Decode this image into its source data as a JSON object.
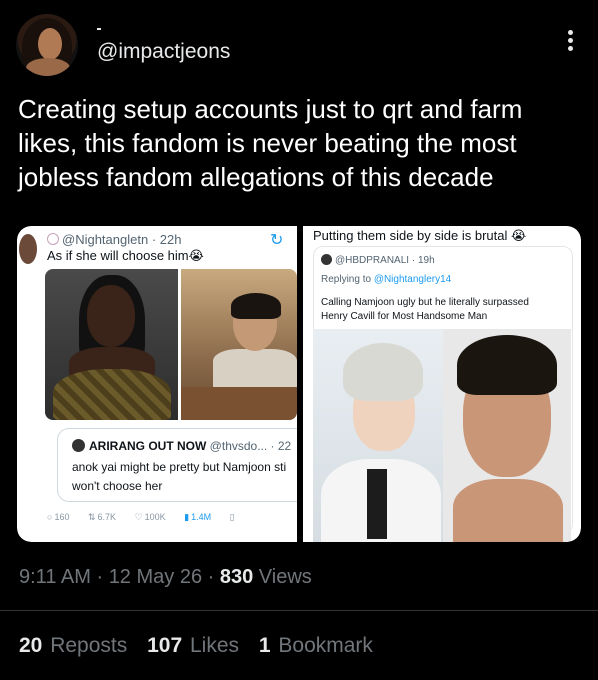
{
  "author": {
    "handle": "@impactjeons"
  },
  "tweet": {
    "text": "Creating setup accounts just to qrt and farm likes, this fandom is never beating the most jobless fandom allegations of this decade"
  },
  "media_left": {
    "user": "@Nightangletn",
    "time": "· 22h",
    "caption": "As if she will choose him😭",
    "quote_name": "ARIRANG OUT NOW",
    "quote_handle": "@thvsdo... · 22",
    "quote_line1": "anok yai might be pretty but Namjoon sti",
    "quote_line2": "won't choose her",
    "stat_replies": "160",
    "stat_reposts": "6.7K",
    "stat_likes": "100K",
    "stat_views": "1.4M"
  },
  "media_right": {
    "caption": "Putting them side by side is brutal 😭",
    "user": "@HBDPRANALI · 19h",
    "replying_prefix": "Replying to ",
    "replying_handle": "@Nightanglery14",
    "text_line1": "Calling Namjoon ugly but he literally surpassed",
    "text_line2": "Henry Cavill for Most Handsome Man"
  },
  "meta": {
    "time": "9:11 AM",
    "date": "12 May 26",
    "views_count": "830",
    "views_label": "Views"
  },
  "counts": {
    "reposts_count": "20",
    "reposts_label": "Reposts",
    "likes_count": "107",
    "likes_label": "Likes",
    "bookmarks_count": "1",
    "bookmarks_label": "Bookmark"
  },
  "colors": {
    "background": "#000000",
    "text": "#e7e9ea",
    "muted": "#71767b",
    "accent": "#1d9bf0"
  }
}
